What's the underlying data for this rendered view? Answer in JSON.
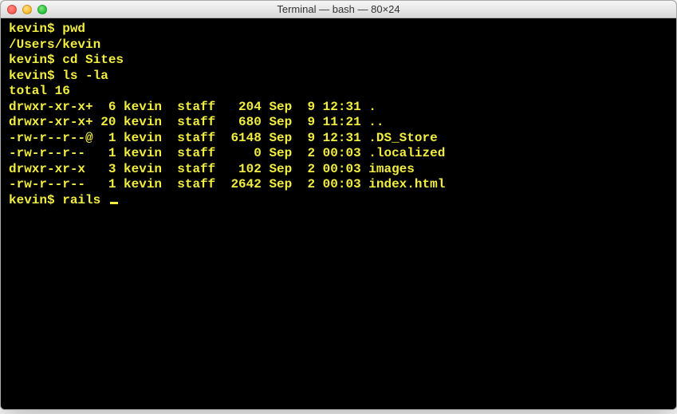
{
  "titlebar": {
    "title": "Terminal — bash — 80×24"
  },
  "terminal": {
    "lines": [
      "kevin$ pwd",
      "/Users/kevin",
      "kevin$ cd Sites",
      "kevin$ ls -la",
      "total 16",
      "drwxr-xr-x+  6 kevin  staff   204 Sep  9 12:31 .",
      "drwxr-xr-x+ 20 kevin  staff   680 Sep  9 11:21 ..",
      "-rw-r--r--@  1 kevin  staff  6148 Sep  9 12:31 .DS_Store",
      "-rw-r--r--   1 kevin  staff     0 Sep  2 00:03 .localized",
      "drwxr-xr-x   3 kevin  staff   102 Sep  2 00:03 images",
      "-rw-r--r--   1 kevin  staff  2642 Sep  2 00:03 index.html"
    ],
    "current_prompt": "kevin$ ",
    "current_input": "rails "
  }
}
